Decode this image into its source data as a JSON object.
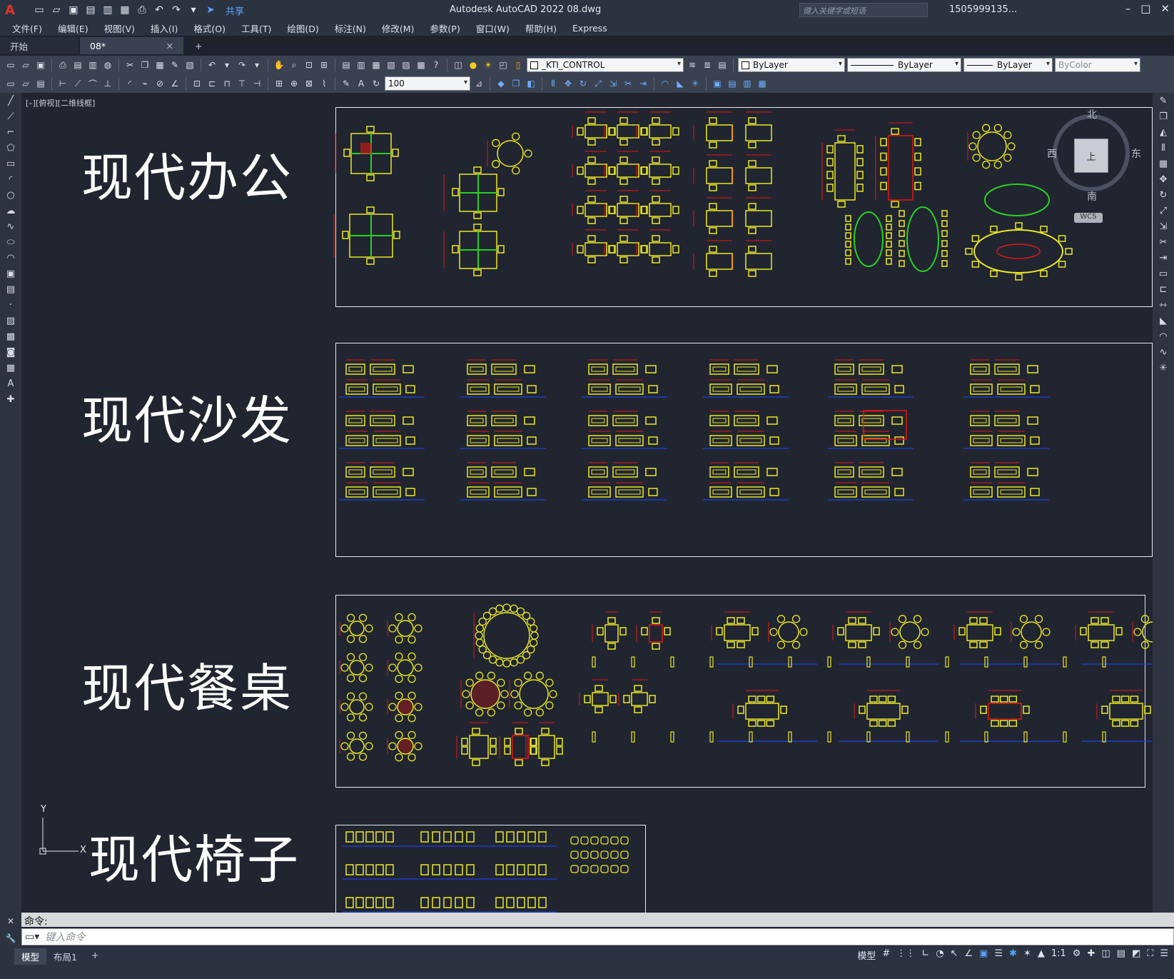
{
  "titlebar": {
    "app_title": "Autodesk AutoCAD 2022    08.dwg",
    "share_label": "共享",
    "search_placeholder": "键入关键字或短语",
    "user": "1505999135...",
    "minimize": "–",
    "maximize": "□",
    "close": "✕"
  },
  "menu": [
    "文件(F)",
    "编辑(E)",
    "视图(V)",
    "插入(I)",
    "格式(O)",
    "工具(T)",
    "绘图(D)",
    "标注(N)",
    "修改(M)",
    "参数(P)",
    "窗口(W)",
    "帮助(H)",
    "Express"
  ],
  "tabs": {
    "start": "开始",
    "drawing": "08*",
    "close": "✕",
    "add": "+"
  },
  "toolbar": {
    "layer": "_KTI_CONTROL",
    "color": "ByLayer",
    "linetype": "ByLayer",
    "lineweight": "ByLayer",
    "plotstyle": "ByColor",
    "dim_scale": "100"
  },
  "viewport": {
    "label": "[–][俯视][二维线框]",
    "viewcube": {
      "north": "北",
      "south": "南",
      "east": "东",
      "west": "西",
      "top": "上",
      "wcs": "WCS"
    }
  },
  "sections": [
    {
      "title": "现代办公"
    },
    {
      "title": "现代沙发"
    },
    {
      "title": "现代餐桌"
    },
    {
      "title": "现代椅子"
    }
  ],
  "ucs": {
    "y": "Y",
    "x": "X"
  },
  "command": {
    "history": "命令:",
    "placeholder": "键入命令"
  },
  "status": {
    "model_tab": "模型",
    "layout_tab": "布局1",
    "add_tab": "+",
    "model": "模型",
    "scale": "1:1"
  },
  "colors": {
    "background": "#21252f",
    "cad_yellow": "#e8e82a",
    "cad_red": "#e01818",
    "cad_green": "#28d028",
    "cad_blue": "#2040e0",
    "frame": "#e6e8ee"
  }
}
